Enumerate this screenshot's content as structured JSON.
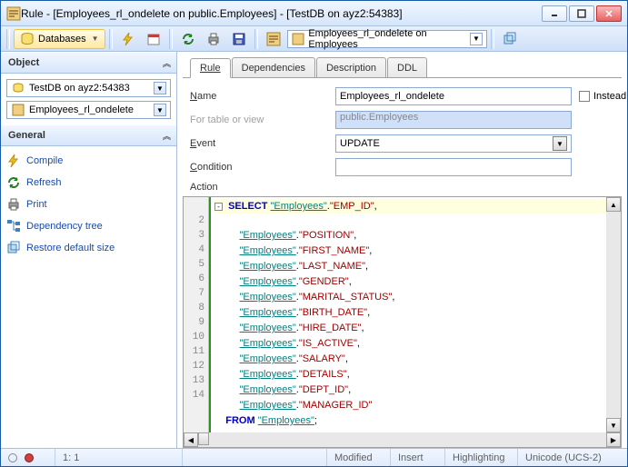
{
  "titlebar": "Rule - [Employees_rl_ondelete on public.Employees] - [TestDB on ayz2:54383]",
  "toolbar": {
    "databases_btn": "Databases",
    "combo_value": "Employees_rl_ondelete on Employees"
  },
  "sections": {
    "object": "Object",
    "general": "General"
  },
  "object_combo1": "TestDB on ayz2:54383",
  "object_combo2": "Employees_rl_ondelete",
  "general_links": {
    "compile": "Compile",
    "refresh": "Refresh",
    "print": "Print",
    "deptree": "Dependency tree",
    "restore": "Restore default size"
  },
  "tabs": {
    "rule": "Rule",
    "dependencies": "Dependencies",
    "description": "Description",
    "ddl": "DDL"
  },
  "form": {
    "name_lbl": "Name",
    "name_val": "Employees_rl_ondelete",
    "fortable_lbl": "For table or view",
    "fortable_val": "public.Employees",
    "event_lbl": "Event",
    "event_val": "UPDATE",
    "condition_lbl": "Condition",
    "condition_val": "",
    "action_lbl": "Action",
    "instead_lbl": "Instead"
  },
  "code_lines": [
    "SELECT \"Employees\".\"EMP_ID\",",
    "       \"Employees\".\"POSITION\",",
    "       \"Employees\".\"FIRST_NAME\",",
    "       \"Employees\".\"LAST_NAME\",",
    "       \"Employees\".\"GENDER\",",
    "       \"Employees\".\"MARITAL_STATUS\",",
    "       \"Employees\".\"BIRTH_DATE\",",
    "       \"Employees\".\"HIRE_DATE\",",
    "       \"Employees\".\"IS_ACTIVE\",",
    "       \"Employees\".\"SALARY\",",
    "       \"Employees\".\"DETAILS\",",
    "       \"Employees\".\"DEPT_ID\",",
    "       \"Employees\".\"MANAGER_ID\"",
    "  FROM \"Employees\";"
  ],
  "status": {
    "pos": "1:   1",
    "modified": "Modified",
    "insert": "Insert",
    "highlight": "Highlighting",
    "encoding": "Unicode (UCS-2)"
  }
}
